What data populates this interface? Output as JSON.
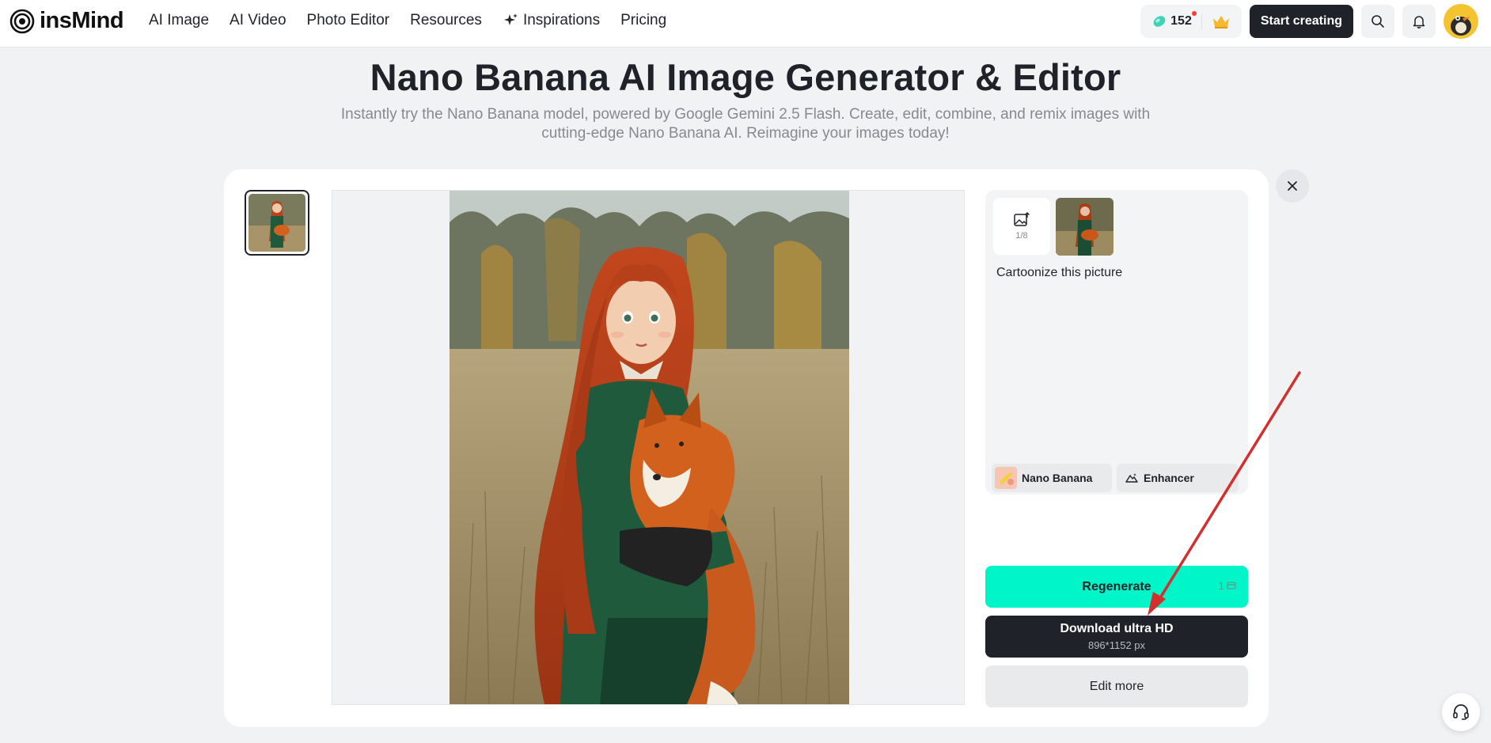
{
  "navbar": {
    "logo_text": "insMind",
    "links": [
      "AI Image",
      "AI Video",
      "Photo Editor",
      "Resources",
      "Inspirations",
      "Pricing"
    ],
    "credits": "152",
    "start_label": "Start creating"
  },
  "hero": {
    "title": "Nano Banana AI Image Generator & Editor",
    "subtitle_line1": "Instantly try the Nano Banana model, powered by Google Gemini 2.5 Flash. Create, edit, combine, and remix images with",
    "subtitle_line2": "cutting-edge Nano Banana AI. Reimagine your images today!"
  },
  "panel": {
    "upload_count": "1/8",
    "prompt": "Cartoonize this picture",
    "model_label": "Nano Banana",
    "enhancer_label": "Enhancer"
  },
  "actions": {
    "regenerate_label": "Regenerate",
    "regenerate_cost": "1",
    "download_label": "Download ultra HD",
    "download_size": "896*1152 px",
    "edit_label": "Edit more"
  },
  "colors": {
    "accent": "#00f5c8",
    "dark": "#1f2329",
    "annotation_arrow": "#d32f2f"
  }
}
